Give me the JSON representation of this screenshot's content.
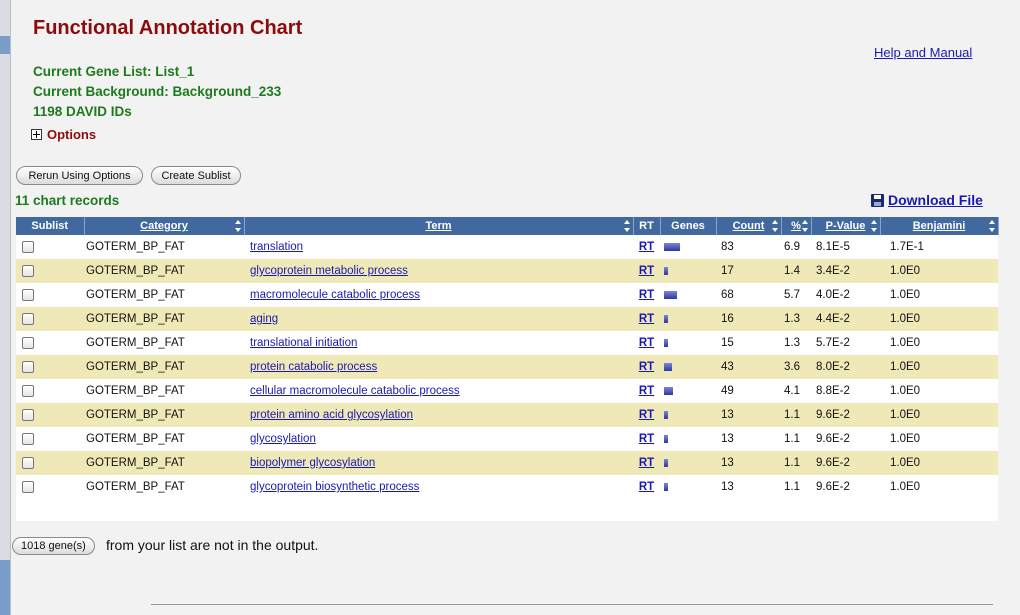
{
  "page": {
    "title": "Functional Annotation Chart",
    "help_link": "Help and Manual",
    "current_gene_list": "Current Gene List: List_1",
    "current_background": "Current Background: Background_233",
    "david_ids": "1198 DAVID IDs",
    "options_label": "Options"
  },
  "buttons": {
    "rerun": "Rerun Using Options",
    "create_sublist": "Create Sublist",
    "genes": "1018 gene(s)"
  },
  "records_label": "11 chart records",
  "download_label": "Download File",
  "table": {
    "headers": [
      "Sublist",
      "Category",
      "Term",
      "RT",
      "Genes",
      "Count",
      "%",
      "P-Value",
      "Benjamini"
    ],
    "rows": [
      {
        "category": "GOTERM_BP_FAT",
        "term": "translation",
        "rt": "RT",
        "count": "83",
        "percent": "6.9",
        "pvalue": "8.1E-5",
        "benjamini": "1.7E-1",
        "gene_fraction": 1.0
      },
      {
        "category": "GOTERM_BP_FAT",
        "term": "glycoprotein metabolic process",
        "rt": "RT",
        "count": "17",
        "percent": "1.4",
        "pvalue": "3.4E-2",
        "benjamini": "1.0E0",
        "gene_fraction": 0.2
      },
      {
        "category": "GOTERM_BP_FAT",
        "term": "macromolecule catabolic process",
        "rt": "RT",
        "count": "68",
        "percent": "5.7",
        "pvalue": "4.0E-2",
        "benjamini": "1.0E0",
        "gene_fraction": 0.82
      },
      {
        "category": "GOTERM_BP_FAT",
        "term": "aging",
        "rt": "RT",
        "count": "16",
        "percent": "1.3",
        "pvalue": "4.4E-2",
        "benjamini": "1.0E0",
        "gene_fraction": 0.19
      },
      {
        "category": "GOTERM_BP_FAT",
        "term": "translational initiation",
        "rt": "RT",
        "count": "15",
        "percent": "1.3",
        "pvalue": "5.7E-2",
        "benjamini": "1.0E0",
        "gene_fraction": 0.18
      },
      {
        "category": "GOTERM_BP_FAT",
        "term": "protein catabolic process",
        "rt": "RT",
        "count": "43",
        "percent": "3.6",
        "pvalue": "8.0E-2",
        "benjamini": "1.0E0",
        "gene_fraction": 0.52
      },
      {
        "category": "GOTERM_BP_FAT",
        "term": "cellular macromolecule catabolic process",
        "rt": "RT",
        "count": "49",
        "percent": "4.1",
        "pvalue": "8.8E-2",
        "benjamini": "1.0E0",
        "gene_fraction": 0.59
      },
      {
        "category": "GOTERM_BP_FAT",
        "term": "protein amino acid glycosylation",
        "rt": "RT",
        "count": "13",
        "percent": "1.1",
        "pvalue": "9.6E-2",
        "benjamini": "1.0E0",
        "gene_fraction": 0.16
      },
      {
        "category": "GOTERM_BP_FAT",
        "term": "glycosylation",
        "rt": "RT",
        "count": "13",
        "percent": "1.1",
        "pvalue": "9.6E-2",
        "benjamini": "1.0E0",
        "gene_fraction": 0.16
      },
      {
        "category": "GOTERM_BP_FAT",
        "term": "biopolymer glycosylation",
        "rt": "RT",
        "count": "13",
        "percent": "1.1",
        "pvalue": "9.6E-2",
        "benjamini": "1.0E0",
        "gene_fraction": 0.16
      },
      {
        "category": "GOTERM_BP_FAT",
        "term": "glycoprotein biosynthetic process",
        "rt": "RT",
        "count": "13",
        "percent": "1.1",
        "pvalue": "9.6E-2",
        "benjamini": "1.0E0",
        "gene_fraction": 0.16
      }
    ]
  },
  "footer_text": "from your list are not in the output.",
  "colors": {
    "title": "#8b0c0c",
    "info": "#1e7a1e",
    "header_bg": "#41699f",
    "row_alt": "#efe9b7",
    "link": "#1a1ab0"
  },
  "icons": {
    "options_toggle": "plus-box-icon",
    "download": "floppy-disk-icon",
    "sort": "sort-arrows-icon"
  }
}
